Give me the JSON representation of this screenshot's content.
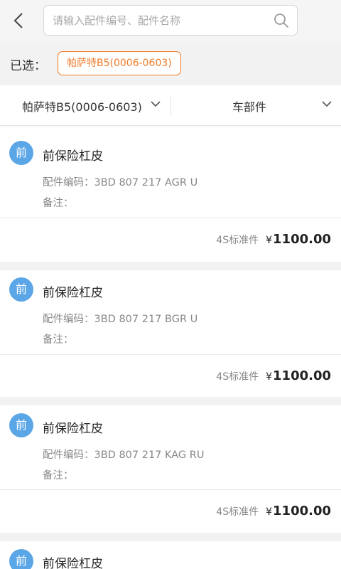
{
  "header": {
    "back_icon": "chevron-left-icon",
    "search_placeholder": "请输入配件编号、配件名称",
    "search_value": "",
    "search_icon": "search-icon"
  },
  "selected": {
    "label": "已选：",
    "chip": "帕萨特B5(0006-0603)"
  },
  "filters": [
    {
      "label": "帕萨特B5(0006-0603)",
      "icon": "chevron-down-icon"
    },
    {
      "label": "车部件",
      "icon": "chevron-down-icon"
    }
  ],
  "items": [
    {
      "avatar": "前",
      "name": "前保险杠皮",
      "code_label": "配件编码：",
      "code": "3BD 807 217 AGR U",
      "note_label": "备注：",
      "note": "",
      "tag": "4S标准件",
      "currency": "¥",
      "price": "1100.00"
    },
    {
      "avatar": "前",
      "name": "前保险杠皮",
      "code_label": "配件编码：",
      "code": "3BD 807 217 BGR U",
      "note_label": "备注：",
      "note": "",
      "tag": "4S标准件",
      "currency": "¥",
      "price": "1100.00"
    },
    {
      "avatar": "前",
      "name": "前保险杠皮",
      "code_label": "配件编码：",
      "code": "3BD 807 217 KAG RU",
      "note_label": "备注：",
      "note": "",
      "tag": "4S标准件",
      "currency": "¥",
      "price": "1100.00"
    },
    {
      "avatar": "前",
      "name": "前保险杠皮"
    }
  ],
  "colors": {
    "accent": "#f07a28",
    "avatar": "#5ba6e6"
  }
}
